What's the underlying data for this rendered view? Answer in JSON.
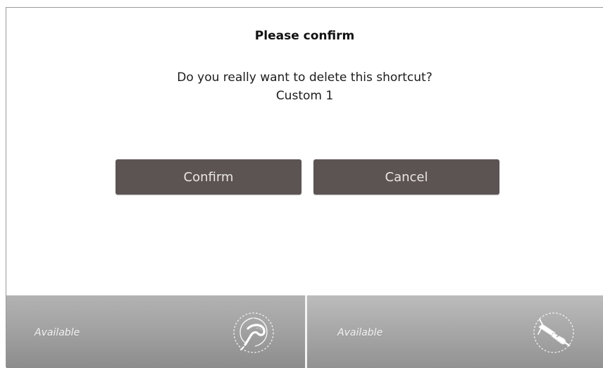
{
  "dialog": {
    "title": "Please confirm",
    "message": "Do you really want to delete this shortcut?",
    "shortcut_name": "Custom 1",
    "confirm_label": "Confirm",
    "cancel_label": "Cancel"
  },
  "tools": [
    {
      "status": "Available",
      "icon": "scaler-tool-icon"
    },
    {
      "status": "Available",
      "icon": "handpiece-tool-icon"
    }
  ],
  "colors": {
    "button_bg": "#5b5452",
    "button_text": "#eae6e4",
    "tray_bg": "#a3a3a3"
  }
}
